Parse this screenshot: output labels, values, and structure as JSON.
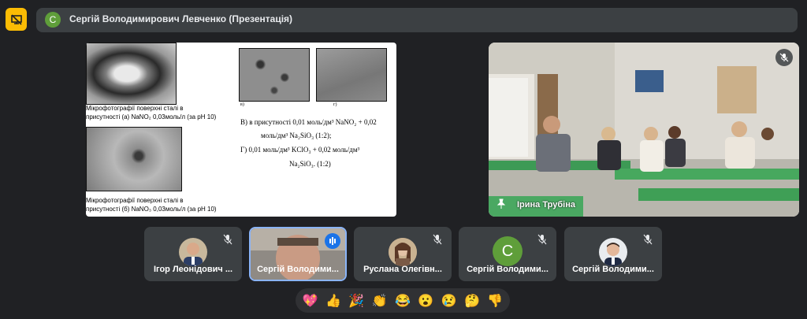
{
  "meeting": {
    "presenter_avatar_letter": "С",
    "presentation_title": "Сергій Володимирович Левченко (Презентація)"
  },
  "slide": {
    "caption_a_line1": "Мікрофотографії поверхні сталі в",
    "caption_a_line2": "присутності (а) NaNO₂ 0,03моль/л (за рН 10)",
    "caption_b_line1": "Мікрофотографії поверхні сталі в",
    "caption_b_line2": "присутності (б) NaNO₃ 0,03моль/л (за рН 10)",
    "label_v": "в)",
    "label_g": "г)",
    "desc_line1": "В) в присутності 0,01 моль/дм³ NaNO₂ + 0,02",
    "desc_line2": "моль/дм³ Na₂SiO₃ (1:2);",
    "desc_line3": "Г) 0,01 моль/дм³ KClO₃ + 0,02 моль/дм³",
    "desc_line4": "Na₂SiO₃. (1:2)"
  },
  "room_tile": {
    "name": "Ірина Трубіна"
  },
  "participants": [
    {
      "name": "Ігор Леонідович ...",
      "type": "photo",
      "speaking": false
    },
    {
      "name": "Сергій Володими...",
      "type": "video",
      "speaking": true
    },
    {
      "name": "Руслана Олегівн...",
      "type": "photo",
      "speaking": false
    },
    {
      "name": "Сергій Володими...",
      "type": "letter",
      "letter": "С",
      "speaking": false
    },
    {
      "name": "Сергій Володими...",
      "type": "photo",
      "speaking": false
    }
  ],
  "reactions": [
    "💖",
    "👍",
    "🎉",
    "👏",
    "😂",
    "😮",
    "😢",
    "🤔",
    "👎"
  ],
  "colors": {
    "background": "#202124",
    "tile": "#3c4043",
    "accent_blue": "#8ab4f8",
    "present_yellow": "#fbbc04",
    "avatar_green": "#5f9e3a"
  }
}
